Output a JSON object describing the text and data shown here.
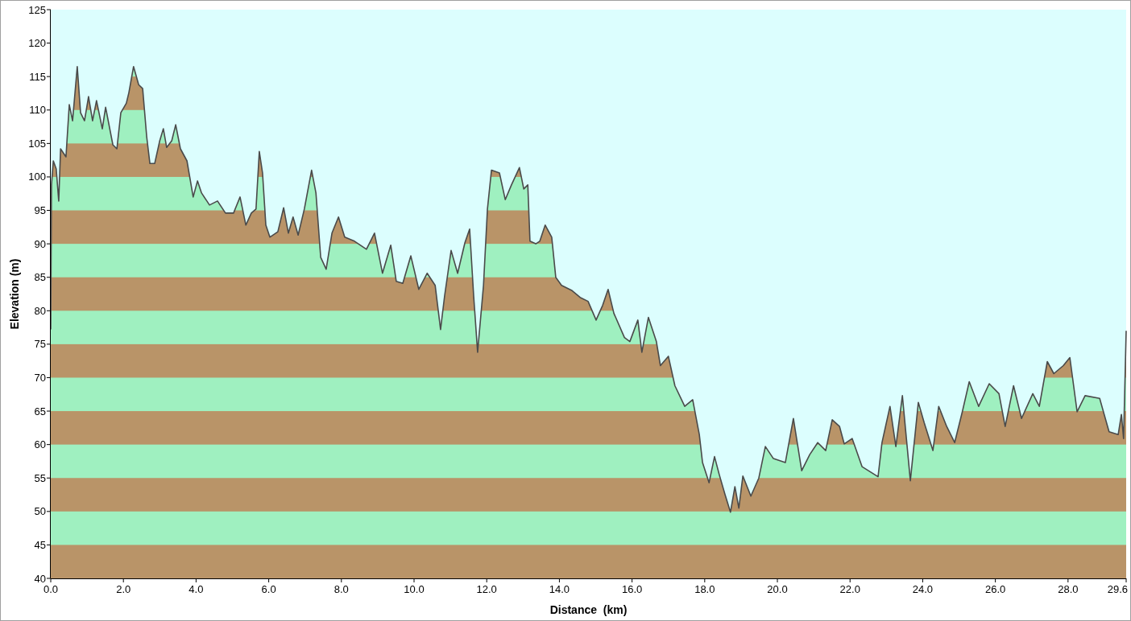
{
  "chart": {
    "chart_data": {
      "type": "area",
      "xlabel": "Distance  (km)",
      "ylabel": "Elevation (m)",
      "xlim": [
        0,
        29.6
      ],
      "ylim": [
        40,
        125
      ],
      "xticks": [
        {
          "value": 0,
          "label": "0.0"
        },
        {
          "value": 2,
          "label": "2.0"
        },
        {
          "value": 4,
          "label": "4.0"
        },
        {
          "value": 6,
          "label": "6.0"
        },
        {
          "value": 8,
          "label": "8.0"
        },
        {
          "value": 10,
          "label": "10.0"
        },
        {
          "value": 12,
          "label": "12.0"
        },
        {
          "value": 14,
          "label": "14.0"
        },
        {
          "value": 16,
          "label": "16.0"
        },
        {
          "value": 18,
          "label": "18.0"
        },
        {
          "value": 20,
          "label": "20.0"
        },
        {
          "value": 22,
          "label": "22.0"
        },
        {
          "value": 24,
          "label": "24.0"
        },
        {
          "value": 26,
          "label": "26.0"
        },
        {
          "value": 28,
          "label": "28.0"
        },
        {
          "value": 29.6,
          "label": "29.6"
        }
      ],
      "yticks": [
        40,
        45,
        50,
        55,
        60,
        65,
        70,
        75,
        80,
        85,
        90,
        95,
        100,
        105,
        110,
        115,
        120,
        125
      ],
      "x": [
        0,
        0.02,
        0.07,
        0.15,
        0.22,
        0.27,
        0.42,
        0.51,
        0.6,
        0.73,
        0.82,
        0.93,
        1.04,
        1.15,
        1.26,
        1.42,
        1.51,
        1.71,
        1.82,
        1.93,
        2.08,
        2.15,
        2.28,
        2.42,
        2.53,
        2.64,
        2.73,
        2.86,
        3.0,
        3.1,
        3.19,
        3.33,
        3.44,
        3.57,
        3.75,
        3.92,
        4.04,
        4.15,
        4.37,
        4.59,
        4.81,
        5.03,
        5.21,
        5.37,
        5.52,
        5.65,
        5.74,
        5.83,
        5.92,
        6.03,
        6.25,
        6.41,
        6.54,
        6.67,
        6.81,
        6.98,
        7.18,
        7.3,
        7.43,
        7.58,
        7.74,
        7.92,
        8.09,
        8.36,
        8.69,
        8.91,
        9.13,
        9.36,
        9.51,
        9.69,
        9.91,
        10.13,
        10.36,
        10.58,
        10.73,
        10.84,
        11.02,
        11.2,
        11.4,
        11.53,
        11.64,
        11.75,
        11.91,
        12.02,
        12.13,
        12.35,
        12.51,
        12.68,
        12.9,
        13.02,
        13.13,
        13.19,
        13.35,
        13.46,
        13.61,
        13.79,
        13.9,
        14.06,
        14.35,
        14.57,
        14.79,
        15.01,
        15.19,
        15.34,
        15.5,
        15.79,
        15.94,
        16.16,
        16.27,
        16.45,
        16.67,
        16.78,
        17.0,
        17.18,
        17.45,
        17.67,
        17.85,
        17.94,
        18.12,
        18.27,
        18.4,
        18.56,
        18.71,
        18.83,
        18.94,
        19.05,
        19.27,
        19.49,
        19.67,
        19.89,
        20.22,
        20.44,
        20.67,
        20.89,
        21.11,
        21.33,
        21.51,
        21.71,
        21.84,
        22.06,
        22.33,
        22.77,
        22.88,
        23.1,
        23.26,
        23.44,
        23.66,
        23.88,
        24.04,
        24.28,
        24.44,
        24.66,
        24.88,
        25.1,
        25.28,
        25.54,
        25.83,
        26.1,
        26.27,
        26.5,
        26.72,
        27.03,
        27.21,
        27.43,
        27.61,
        27.87,
        28.05,
        28.25,
        28.47,
        28.87,
        29.13,
        29.38,
        29.47,
        29.53,
        29.6
      ],
      "series": [
        {
          "color": "#4a4a4a",
          "values": [
            77.2,
            98.8,
            102.4,
            101.2,
            96.4,
            104.2,
            103,
            110.8,
            108.4,
            116.5,
            109.6,
            108.4,
            112,
            108.4,
            111.4,
            107.2,
            110.4,
            104.8,
            104.2,
            109.6,
            111,
            112.6,
            116.5,
            113.8,
            113.2,
            106,
            102,
            102,
            105.4,
            107.2,
            104.4,
            105.4,
            107.8,
            104.2,
            102.4,
            97,
            99.4,
            97.6,
            95.8,
            96.4,
            94.6,
            94.6,
            97,
            92.8,
            94.6,
            95.2,
            103.8,
            100.6,
            92.8,
            91,
            91.8,
            95.4,
            91.6,
            94,
            91.3,
            95.2,
            101,
            97.6,
            88,
            86.2,
            91.6,
            94,
            91,
            90.4,
            89.2,
            91.6,
            85.6,
            89.8,
            84.4,
            84.1,
            88.2,
            83.2,
            85.6,
            83.8,
            77.2,
            82.2,
            89,
            85.6,
            90.2,
            92.2,
            82.2,
            73.8,
            83.8,
            95.2,
            101,
            100.6,
            96.6,
            98.8,
            101.4,
            98.2,
            98.8,
            90.4,
            90,
            90.4,
            92.8,
            91,
            85,
            83.8,
            83,
            82,
            81.4,
            78.6,
            80.8,
            83.2,
            79.6,
            76,
            75.4,
            78.6,
            73.8,
            79,
            75.4,
            71.8,
            73.2,
            68.8,
            65.7,
            66.7,
            61.5,
            57.3,
            54.3,
            58.2,
            55.5,
            52.5,
            49.9,
            53.7,
            50.5,
            55.3,
            52.3,
            55,
            59.7,
            57.9,
            57.3,
            63.9,
            56.1,
            58.5,
            60.3,
            59.1,
            63.7,
            62.7,
            60.1,
            60.9,
            56.7,
            55.2,
            60.3,
            65.7,
            59.7,
            67.3,
            54.6,
            66.3,
            63.3,
            59.1,
            65.7,
            62.7,
            60.3,
            65.1,
            69.4,
            65.7,
            69.1,
            67.6,
            62.7,
            68.8,
            63.9,
            67.6,
            65.7,
            72.4,
            70.6,
            71.8,
            73,
            64.9,
            67.3,
            66.9,
            61.9,
            61.5,
            64.5,
            60.9,
            77
          ]
        }
      ]
    }
  }
}
